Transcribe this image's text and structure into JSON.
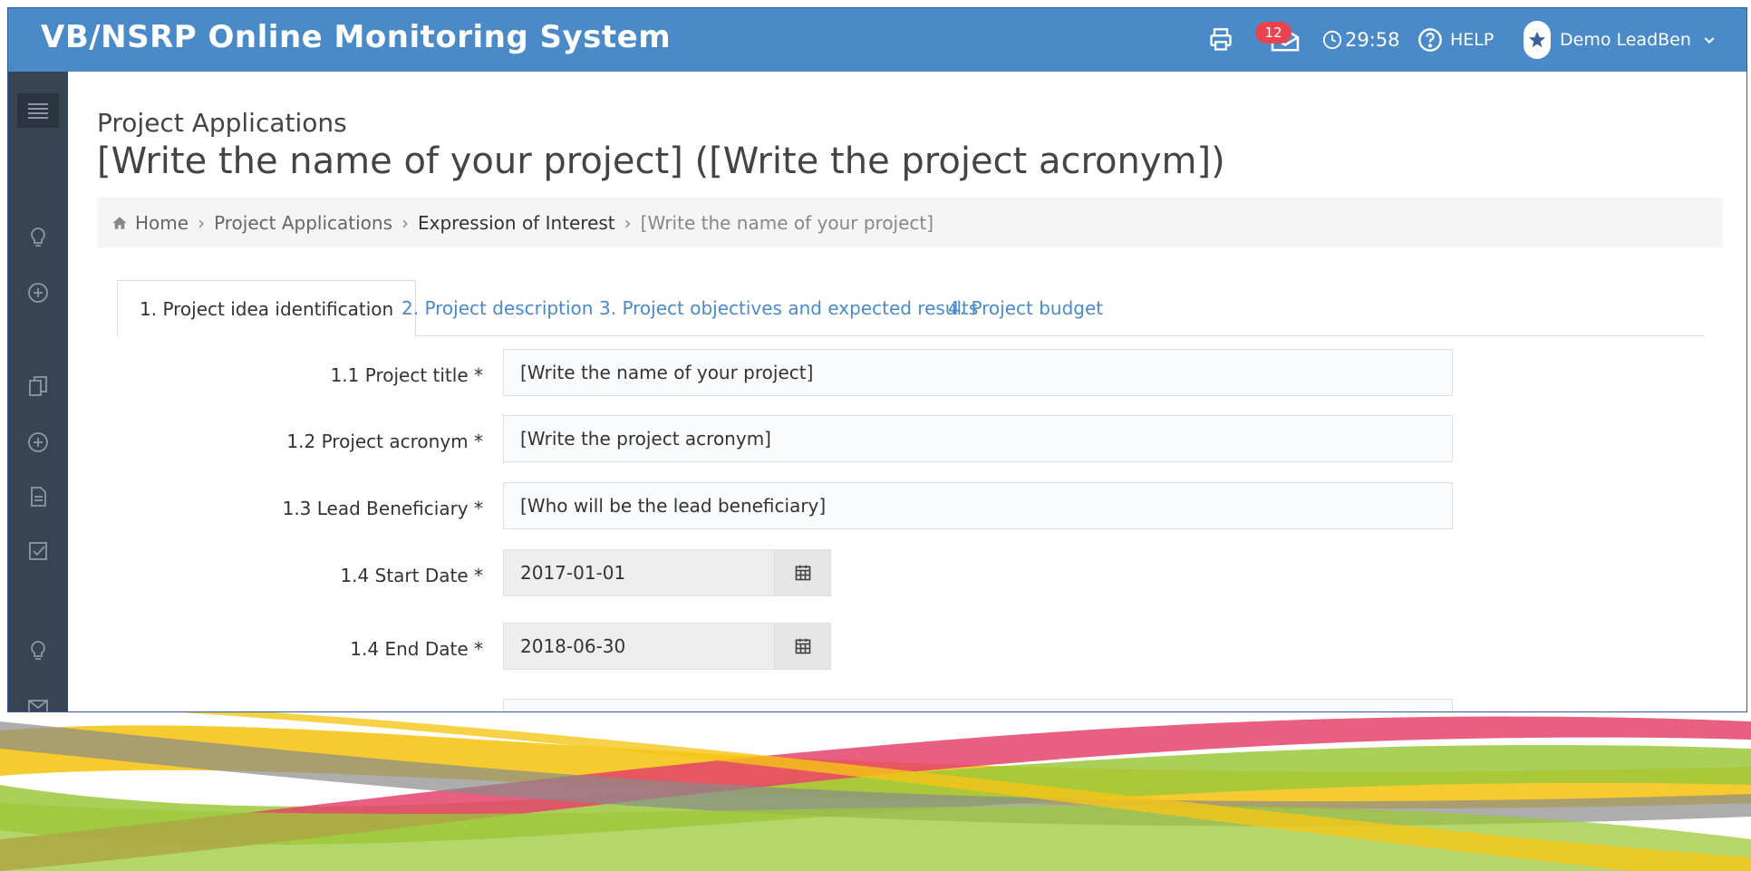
{
  "app": {
    "title": "VB/NSRP Online Monitoring System"
  },
  "topbar": {
    "messages_count": "12",
    "timer": "29:58",
    "help_label": "HELP",
    "user_name": "Demo LeadBen"
  },
  "page": {
    "subtitle": "Project Applications",
    "title": "[Write the name of your project] ([Write the project acronym])"
  },
  "breadcrumb": [
    "Home",
    "Project Applications",
    "Expression of Interest",
    "[Write the name of your project]"
  ],
  "tabs": [
    {
      "label": "1. Project idea identification"
    },
    {
      "label": "2. Project description"
    },
    {
      "label": "3. Project objectives and expected results"
    },
    {
      "label": "4. Project budget"
    }
  ],
  "form": {
    "project_title": {
      "label": "1.1 Project title *",
      "value": "[Write the name of your project]"
    },
    "project_acronym": {
      "label": "1.2 Project acronym *",
      "value": "[Write the project acronym]"
    },
    "lead_beneficiary": {
      "label": "1.3 Lead Beneficiary *",
      "value": "[Who will be the lead beneficiary]"
    },
    "start_date": {
      "label": "1.4 Start Date *",
      "value": "2017-01-01"
    },
    "end_date": {
      "label": "1.4 End Date *",
      "value": "2018-06-30"
    }
  },
  "colors": {
    "header": "#4a8ac9",
    "sidebar": "#384451",
    "badge": "#e8434f",
    "link": "#4a8ac9",
    "ribbon_yellow": "#f5c518",
    "ribbon_green": "#9cc83a",
    "ribbon_pink": "#e4436b",
    "ribbon_gray": "#8a8a8a"
  },
  "icons": [
    "printer-icon",
    "envelope-icon",
    "clock-icon",
    "help-icon",
    "user-avatar-icon",
    "chevron-down-icon",
    "menu-icon",
    "lightbulb-icon",
    "plus-circle-icon",
    "documents-icon",
    "file-icon",
    "checkbox-icon",
    "calendar-icon",
    "home-icon"
  ]
}
